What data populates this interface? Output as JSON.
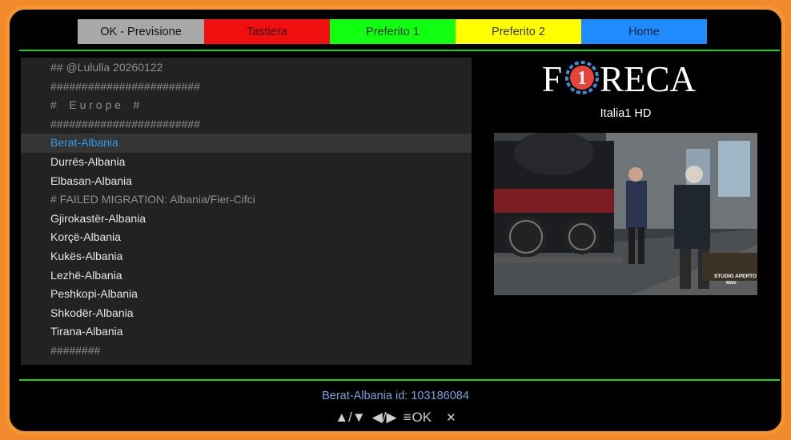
{
  "buttons": {
    "ok": "OK - Previsione",
    "red": "Tastiera",
    "green": "Preferito 1",
    "yellow": "Preferito 2",
    "blue": "Home"
  },
  "list": [
    {
      "text": "## @Lululla 20260122",
      "type": "comment"
    },
    {
      "text": "########################",
      "type": "comment"
    },
    {
      "text": "#    E u r o p e    #",
      "type": "comment"
    },
    {
      "text": "########################",
      "type": "comment"
    },
    {
      "text": "Berat-Albania",
      "type": "selected"
    },
    {
      "text": "Durrës-Albania",
      "type": "item"
    },
    {
      "text": "Elbasan-Albania",
      "type": "item"
    },
    {
      "text": "# FAILED MIGRATION: Albania/Fier-Cifci",
      "type": "comment"
    },
    {
      "text": "Gjirokastër-Albania",
      "type": "item"
    },
    {
      "text": "Korçë-Albania",
      "type": "item"
    },
    {
      "text": "Kukës-Albania",
      "type": "item"
    },
    {
      "text": "Lezhë-Albania",
      "type": "item"
    },
    {
      "text": "Peshkopi-Albania",
      "type": "item"
    },
    {
      "text": "Shkodër-Albania",
      "type": "item"
    },
    {
      "text": "Tirana-Albania",
      "type": "item"
    },
    {
      "text": "########",
      "type": "comment"
    }
  ],
  "logo": {
    "text": "FORECA",
    "circle_digit": "1"
  },
  "channel": "Italia1 HD",
  "preview": {
    "watermark_line1": "STUDIO APERTO",
    "watermark_line2": "MAG"
  },
  "status": "Berat-Albania  id: 103186084",
  "keys": {
    "updown": "▲/▼",
    "leftright": "◀/▶",
    "menu": "≡",
    "ok": "OK",
    "close": "✕"
  },
  "colors": {
    "frame": "#f4952f",
    "separator": "#1ed21e",
    "selected_text": "#2f9be8",
    "logo_circle": "#e8433a",
    "logo_gear": "#3c8fd6"
  }
}
